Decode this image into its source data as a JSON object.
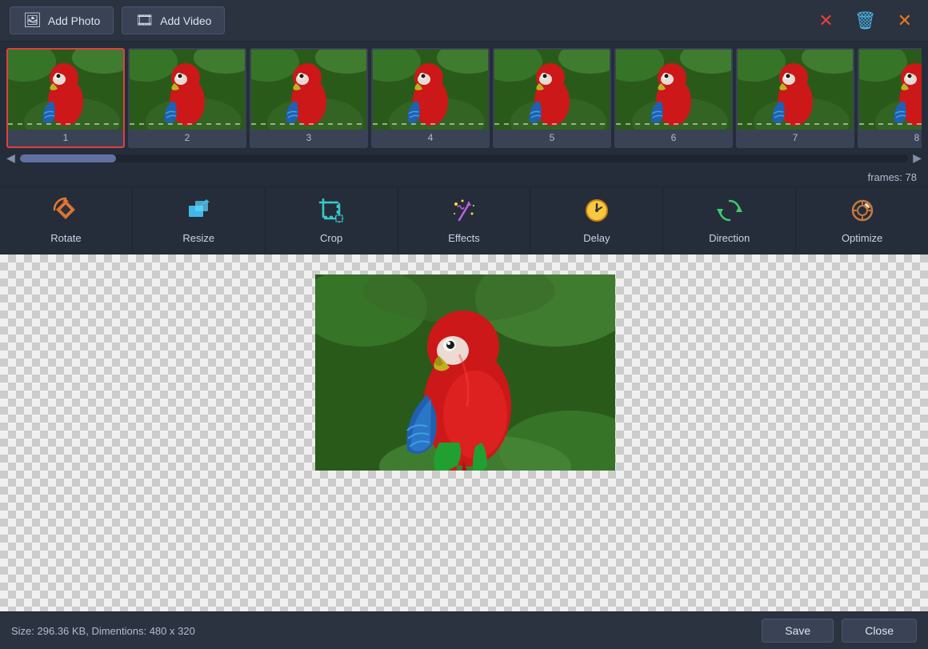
{
  "toolbar": {
    "add_photo_label": "Add Photo",
    "add_video_label": "Add Video",
    "delete_icon": "🗑",
    "close_icon": "✕",
    "x_icon": "✕"
  },
  "filmstrip": {
    "frames": [
      {
        "id": 1,
        "label": "1",
        "selected": true
      },
      {
        "id": 2,
        "label": "2",
        "selected": false
      },
      {
        "id": 3,
        "label": "3",
        "selected": false
      },
      {
        "id": 4,
        "label": "4",
        "selected": false
      },
      {
        "id": 5,
        "label": "5",
        "selected": false
      },
      {
        "id": 6,
        "label": "6",
        "selected": false
      },
      {
        "id": 7,
        "label": "7",
        "selected": false
      },
      {
        "id": 8,
        "label": "8",
        "selected": false
      }
    ],
    "frames_count_label": "frames: 78"
  },
  "tools": [
    {
      "id": "rotate",
      "label": "Rotate"
    },
    {
      "id": "resize",
      "label": "Resize"
    },
    {
      "id": "crop",
      "label": "Crop"
    },
    {
      "id": "effects",
      "label": "Effects"
    },
    {
      "id": "delay",
      "label": "Delay"
    },
    {
      "id": "direction",
      "label": "Direction"
    },
    {
      "id": "optimize",
      "label": "Optimize"
    }
  ],
  "status": {
    "size_label": "Size: 296.36 KB,   Dimentions: 480 x 320"
  },
  "buttons": {
    "save_label": "Save",
    "close_label": "Close"
  }
}
